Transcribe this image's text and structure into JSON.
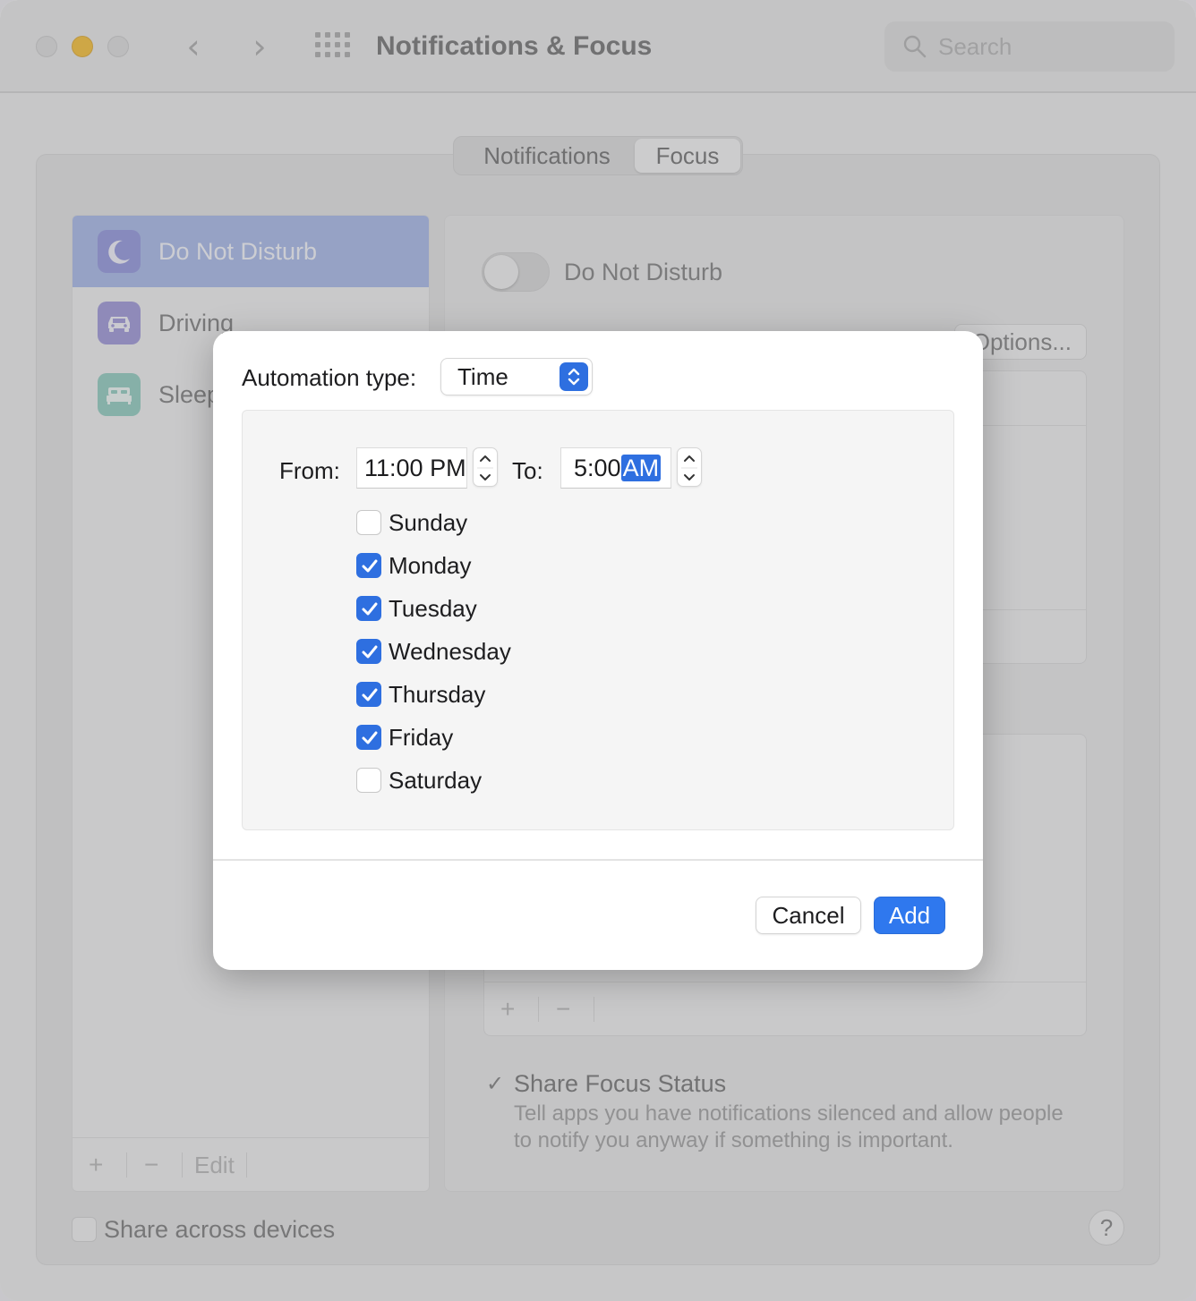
{
  "window": {
    "title": "Notifications & Focus",
    "search_placeholder": "Search"
  },
  "tabs": [
    {
      "label": "Notifications",
      "selected": false
    },
    {
      "label": "Focus",
      "selected": true
    }
  ],
  "focus_list": {
    "items": [
      {
        "label": "Do Not Disturb",
        "icon": "moon-icon",
        "color": "#7b7fd6",
        "selected": true
      },
      {
        "label": "Driving",
        "icon": "car-icon",
        "color": "#8f86d8",
        "selected": false
      },
      {
        "label": "Sleep",
        "icon": "bed-icon",
        "color": "#7fc3b5",
        "selected": false
      }
    ],
    "add_label": "+",
    "remove_label": "−",
    "edit_label": "Edit"
  },
  "detail": {
    "toggle_label": "Do Not Disturb",
    "toggle_on": false,
    "options_label": "Options...",
    "share_focus_label": "Share Focus Status",
    "share_focus_checked": true,
    "share_focus_desc": "Tell apps you have notifications silenced and allow people to notify you anyway if something is important."
  },
  "footer": {
    "share_devices_label": "Share across devices",
    "help_label": "?"
  },
  "dialog": {
    "automation_label": "Automation type:",
    "automation_value": "Time",
    "from_label": "From:",
    "from_time": "11:00 PM",
    "to_label": "To:",
    "to_time": "5:00",
    "to_ampm": "AM",
    "days": [
      {
        "label": "Sunday",
        "checked": false
      },
      {
        "label": "Monday",
        "checked": true
      },
      {
        "label": "Tuesday",
        "checked": true
      },
      {
        "label": "Wednesday",
        "checked": true
      },
      {
        "label": "Thursday",
        "checked": true
      },
      {
        "label": "Friday",
        "checked": true
      },
      {
        "label": "Saturday",
        "checked": false
      }
    ],
    "cancel_label": "Cancel",
    "add_label": "Add"
  },
  "colors": {
    "accent": "#2e6fe0",
    "selection": "#a4b6e8",
    "traffic_min": "#f6bd2d"
  }
}
